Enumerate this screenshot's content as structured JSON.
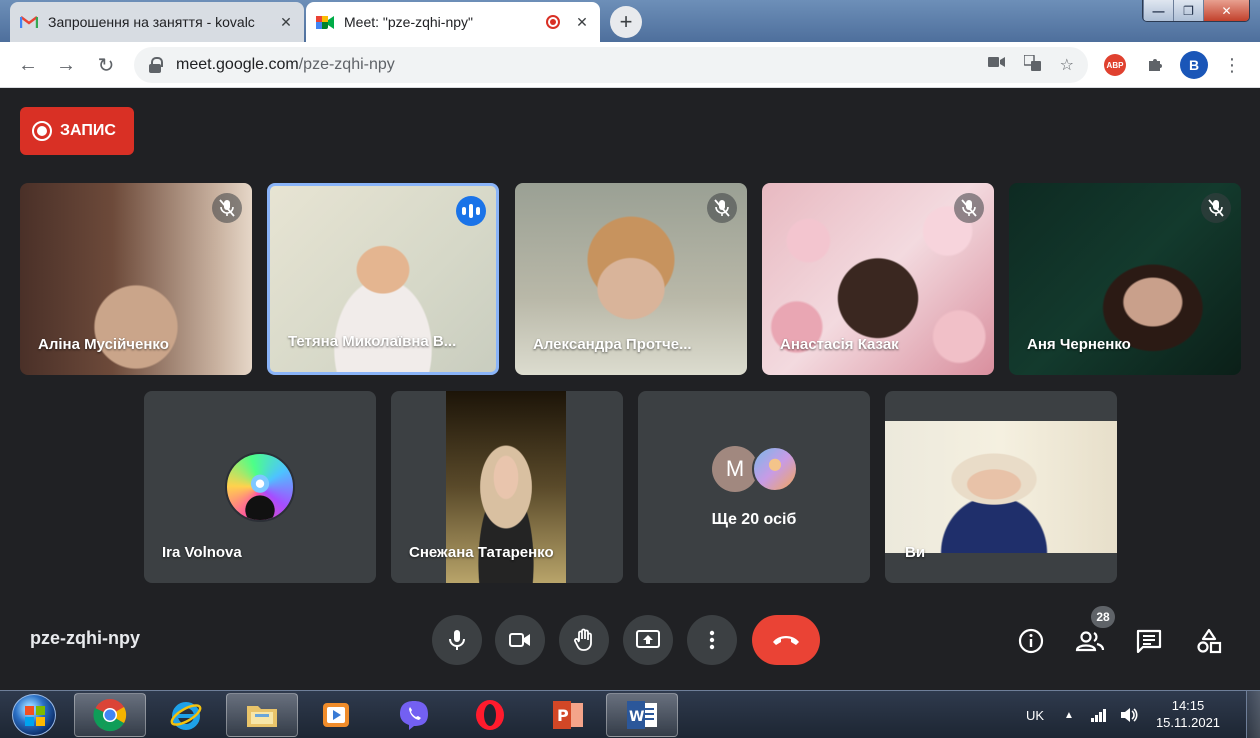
{
  "browser": {
    "tabs": [
      {
        "title": "Запрошення на заняття - kovalc",
        "favicon": "gmail-icon",
        "active": false
      },
      {
        "title": "Meet: \"pze-zqhi-npy\"",
        "favicon": "google-meet-icon",
        "active": true
      }
    ],
    "url_domain": "meet.google.com",
    "url_path": "/pze-zqhi-npy",
    "abp_label": "ABP",
    "profile_initial": "B"
  },
  "meet": {
    "record_label": "ЗАПИС",
    "meeting_code": "pze-zqhi-npy",
    "participants_count": "28",
    "tiles": [
      {
        "name": "Аліна Мусійченко",
        "muted": true
      },
      {
        "name": "Тетяна Миколаївна В...",
        "muted": false,
        "speaking": true
      },
      {
        "name": "Александра Протче...",
        "muted": true
      },
      {
        "name": "Анастасія Казак",
        "muted": true
      },
      {
        "name": "Аня Черненко",
        "muted": true
      },
      {
        "name": "Ira Volnova"
      },
      {
        "name": "Снежана Татаренко"
      },
      {
        "more_label": "Ще 20 осіб",
        "avatar_initial": "M"
      },
      {
        "name": "Ви"
      }
    ],
    "colors": {
      "background": "#202124",
      "tile": "#3c4043",
      "record": "#d93025",
      "hangup": "#ea4335",
      "active_border": "#8ab4f8"
    }
  },
  "taskbar": {
    "language": "UK",
    "time": "14:15",
    "date": "15.11.2021"
  }
}
